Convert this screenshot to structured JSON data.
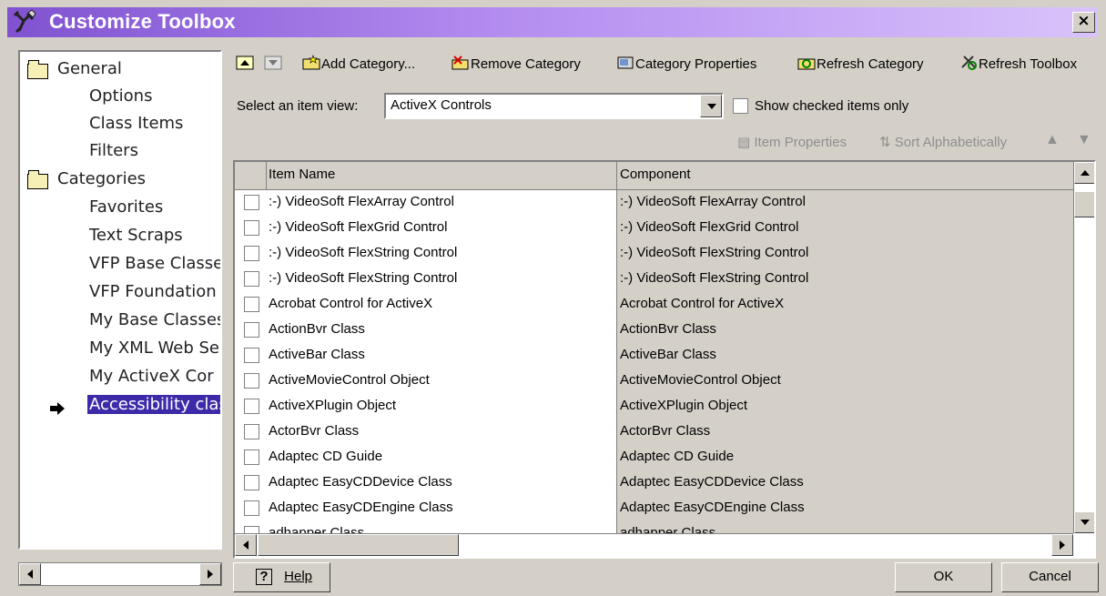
{
  "window": {
    "title": "Customize Toolbox",
    "close_label": "×"
  },
  "sidebar": {
    "items": [
      {
        "label": "General",
        "type": "folder"
      },
      {
        "label": "Options",
        "type": "child"
      },
      {
        "label": "Class Items",
        "type": "child"
      },
      {
        "label": "Filters",
        "type": "child"
      },
      {
        "label": "Categories",
        "type": "folder"
      },
      {
        "label": "Favorites",
        "type": "child"
      },
      {
        "label": "Text Scraps",
        "type": "child"
      },
      {
        "label": "VFP Base Classe",
        "type": "child"
      },
      {
        "label": "VFP Foundation",
        "type": "child"
      },
      {
        "label": "My Base Classes",
        "type": "child"
      },
      {
        "label": "My XML Web Se",
        "type": "child"
      },
      {
        "label": "My ActiveX Cor",
        "type": "child"
      },
      {
        "label": "Accessibility clas",
        "type": "selected"
      }
    ]
  },
  "toolbar": {
    "add_category": "Add Category...",
    "remove_category": "Remove Category",
    "category_properties": "Category Properties",
    "refresh_category": "Refresh Category",
    "refresh_toolbox": "Refresh Toolbox",
    "item_properties": "Item Properties",
    "sort_alphabetically": "Sort Alphabetically"
  },
  "view_filter": {
    "label": "Select an item view:",
    "selected_value": "ActiveX Controls",
    "checked_only_label": "Show checked items only",
    "checked_only": false
  },
  "grid": {
    "columns": [
      "Item Name",
      "Component"
    ],
    "rows": [
      [
        ":-) VideoSoft FlexArray Control",
        ":-) VideoSoft FlexArray Control"
      ],
      [
        ":-) VideoSoft FlexGrid Control",
        ":-) VideoSoft FlexGrid Control"
      ],
      [
        ":-) VideoSoft FlexString Control",
        ":-) VideoSoft FlexString Control"
      ],
      [
        ":-) VideoSoft FlexString Control",
        ":-) VideoSoft FlexString Control"
      ],
      [
        "Acrobat Control for ActiveX",
        "Acrobat Control for ActiveX"
      ],
      [
        "ActionBvr Class",
        "ActionBvr Class"
      ],
      [
        "ActiveBar Class",
        "ActiveBar Class"
      ],
      [
        "ActiveMovieControl Object",
        "ActiveMovieControl Object"
      ],
      [
        "ActiveXPlugin Object",
        "ActiveXPlugin Object"
      ],
      [
        "ActorBvr Class",
        "ActorBvr Class"
      ],
      [
        "Adaptec CD Guide",
        "Adaptec CD Guide"
      ],
      [
        "Adaptec EasyCDDevice Class",
        "Adaptec EasyCDDevice Class"
      ],
      [
        "Adaptec EasyCDEngine Class",
        "Adaptec EasyCDEngine Class"
      ],
      [
        "adhapper Class",
        "adhapper Class"
      ]
    ]
  },
  "footer": {
    "help": "Help",
    "ok": "OK",
    "cancel": "Cancel"
  },
  "icons": {
    "title": "tools-icon",
    "folder": "folder-icon",
    "selected_arrow": "right-arrow-icon",
    "up": "up-icon",
    "down": "down-icon"
  },
  "colors": {
    "title_gradient_start": "#8052d0",
    "title_gradient_end": "#d9c3fb",
    "selection": "#3d2aa9",
    "panel": "#d4d0c8"
  }
}
